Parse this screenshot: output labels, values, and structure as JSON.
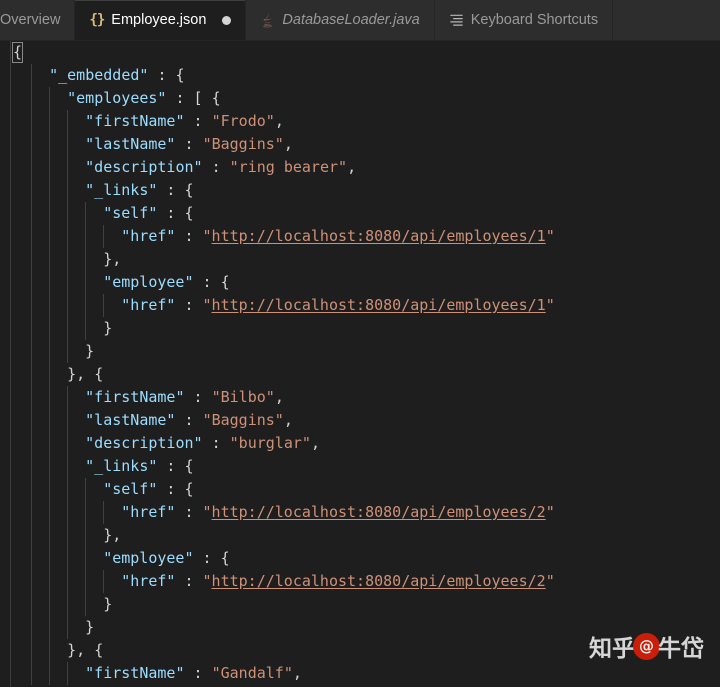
{
  "window": {
    "theme": "dark",
    "background": "#1e1e1e",
    "tabbar_background": "#2d2d2d"
  },
  "tabbar": {
    "tabs": [
      {
        "label": "Overview",
        "icon": "none",
        "active": false,
        "italic": false,
        "dirty": false
      },
      {
        "label": "Employee.json",
        "icon": "json-icon",
        "active": true,
        "italic": false,
        "dirty": true
      },
      {
        "label": "DatabaseLoader.java",
        "icon": "java-icon",
        "active": false,
        "italic": true,
        "dirty": false
      },
      {
        "label": "Keyboard Shortcuts",
        "icon": "list-icon",
        "active": false,
        "italic": false,
        "dirty": false
      }
    ]
  },
  "colors": {
    "key": "#9cdcfe",
    "string": "#ce9178",
    "punctuation": "#d4d4d4",
    "accent": "#d7ba7d",
    "watermark_logo": "#d81e06"
  },
  "editor": {
    "language": "json",
    "filename": "Employee.json",
    "lines": [
      {
        "indent": 0,
        "tokens": [
          {
            "t": "bracket-highlight",
            "v": "{"
          }
        ]
      },
      {
        "indent": 2,
        "tokens": [
          {
            "t": "key",
            "v": "\"_embedded\""
          },
          {
            "t": "p",
            "v": " : "
          },
          {
            "t": "p",
            "v": "{"
          }
        ]
      },
      {
        "indent": 3,
        "tokens": [
          {
            "t": "key",
            "v": "\"employees\""
          },
          {
            "t": "p",
            "v": " : "
          },
          {
            "t": "p",
            "v": "[ {"
          }
        ]
      },
      {
        "indent": 4,
        "tokens": [
          {
            "t": "key",
            "v": "\"firstName\""
          },
          {
            "t": "p",
            "v": " : "
          },
          {
            "t": "s",
            "v": "\"Frodo\""
          },
          {
            "t": "p",
            "v": ","
          }
        ]
      },
      {
        "indent": 4,
        "tokens": [
          {
            "t": "key",
            "v": "\"lastName\""
          },
          {
            "t": "p",
            "v": " : "
          },
          {
            "t": "s",
            "v": "\"Baggins\""
          },
          {
            "t": "p",
            "v": ","
          }
        ]
      },
      {
        "indent": 4,
        "tokens": [
          {
            "t": "key",
            "v": "\"description\""
          },
          {
            "t": "p",
            "v": " : "
          },
          {
            "t": "s",
            "v": "\"ring bearer\""
          },
          {
            "t": "p",
            "v": ","
          }
        ]
      },
      {
        "indent": 4,
        "tokens": [
          {
            "t": "key",
            "v": "\"_links\""
          },
          {
            "t": "p",
            "v": " : "
          },
          {
            "t": "p",
            "v": "{"
          }
        ]
      },
      {
        "indent": 5,
        "tokens": [
          {
            "t": "key",
            "v": "\"self\""
          },
          {
            "t": "p",
            "v": " : "
          },
          {
            "t": "p",
            "v": "{"
          }
        ]
      },
      {
        "indent": 6,
        "tokens": [
          {
            "t": "key",
            "v": "\"href\""
          },
          {
            "t": "p",
            "v": " : "
          },
          {
            "t": "q",
            "v": "\""
          },
          {
            "t": "url",
            "v": "http://localhost:8080/api/employees/1"
          },
          {
            "t": "q",
            "v": "\""
          }
        ]
      },
      {
        "indent": 5,
        "tokens": [
          {
            "t": "p",
            "v": "},"
          }
        ]
      },
      {
        "indent": 5,
        "tokens": [
          {
            "t": "key",
            "v": "\"employee\""
          },
          {
            "t": "p",
            "v": " : "
          },
          {
            "t": "p",
            "v": "{"
          }
        ]
      },
      {
        "indent": 6,
        "tokens": [
          {
            "t": "key",
            "v": "\"href\""
          },
          {
            "t": "p",
            "v": " : "
          },
          {
            "t": "q",
            "v": "\""
          },
          {
            "t": "url",
            "v": "http://localhost:8080/api/employees/1"
          },
          {
            "t": "q",
            "v": "\""
          }
        ]
      },
      {
        "indent": 5,
        "tokens": [
          {
            "t": "p",
            "v": "}"
          }
        ]
      },
      {
        "indent": 4,
        "tokens": [
          {
            "t": "p",
            "v": "}"
          }
        ]
      },
      {
        "indent": 3,
        "tokens": [
          {
            "t": "p",
            "v": "}, {"
          }
        ]
      },
      {
        "indent": 4,
        "tokens": [
          {
            "t": "key",
            "v": "\"firstName\""
          },
          {
            "t": "p",
            "v": " : "
          },
          {
            "t": "s",
            "v": "\"Bilbo\""
          },
          {
            "t": "p",
            "v": ","
          }
        ]
      },
      {
        "indent": 4,
        "tokens": [
          {
            "t": "key",
            "v": "\"lastName\""
          },
          {
            "t": "p",
            "v": " : "
          },
          {
            "t": "s",
            "v": "\"Baggins\""
          },
          {
            "t": "p",
            "v": ","
          }
        ]
      },
      {
        "indent": 4,
        "tokens": [
          {
            "t": "key",
            "v": "\"description\""
          },
          {
            "t": "p",
            "v": " : "
          },
          {
            "t": "s",
            "v": "\"burglar\""
          },
          {
            "t": "p",
            "v": ","
          }
        ]
      },
      {
        "indent": 4,
        "tokens": [
          {
            "t": "key",
            "v": "\"_links\""
          },
          {
            "t": "p",
            "v": " : "
          },
          {
            "t": "p",
            "v": "{"
          }
        ]
      },
      {
        "indent": 5,
        "tokens": [
          {
            "t": "key",
            "v": "\"self\""
          },
          {
            "t": "p",
            "v": " : "
          },
          {
            "t": "p",
            "v": "{"
          }
        ]
      },
      {
        "indent": 6,
        "tokens": [
          {
            "t": "key",
            "v": "\"href\""
          },
          {
            "t": "p",
            "v": " : "
          },
          {
            "t": "q",
            "v": "\""
          },
          {
            "t": "url",
            "v": "http://localhost:8080/api/employees/2"
          },
          {
            "t": "q",
            "v": "\""
          }
        ]
      },
      {
        "indent": 5,
        "tokens": [
          {
            "t": "p",
            "v": "},"
          }
        ]
      },
      {
        "indent": 5,
        "tokens": [
          {
            "t": "key",
            "v": "\"employee\""
          },
          {
            "t": "p",
            "v": " : "
          },
          {
            "t": "p",
            "v": "{"
          }
        ]
      },
      {
        "indent": 6,
        "tokens": [
          {
            "t": "key",
            "v": "\"href\""
          },
          {
            "t": "p",
            "v": " : "
          },
          {
            "t": "q",
            "v": "\""
          },
          {
            "t": "url",
            "v": "http://localhost:8080/api/employees/2"
          },
          {
            "t": "q",
            "v": "\""
          }
        ]
      },
      {
        "indent": 5,
        "tokens": [
          {
            "t": "p",
            "v": "}"
          }
        ]
      },
      {
        "indent": 4,
        "tokens": [
          {
            "t": "p",
            "v": "}"
          }
        ]
      },
      {
        "indent": 3,
        "tokens": [
          {
            "t": "p",
            "v": "}, {"
          }
        ]
      },
      {
        "indent": 4,
        "tokens": [
          {
            "t": "key",
            "v": "\"firstName\""
          },
          {
            "t": "p",
            "v": " : "
          },
          {
            "t": "s",
            "v": "\"Gandalf\""
          },
          {
            "t": "p",
            "v": ","
          }
        ]
      }
    ]
  },
  "watermark": {
    "prefix": "知乎",
    "logo_glyph": "@",
    "suffix": "牛岱"
  }
}
